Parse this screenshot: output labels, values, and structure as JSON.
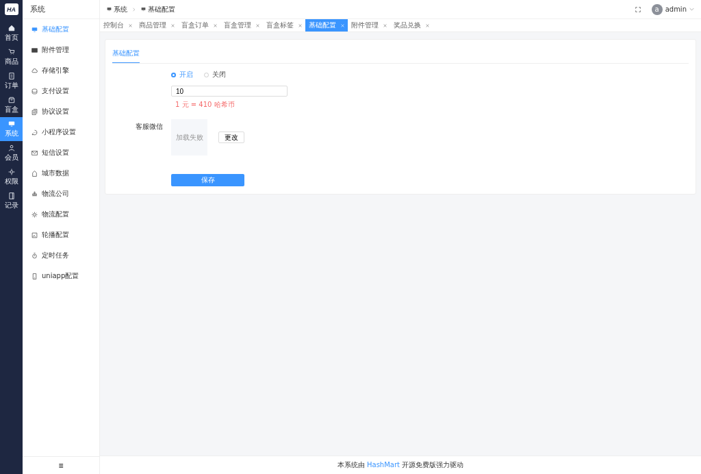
{
  "logo": "HA",
  "rail": [
    {
      "label": "首页",
      "selected": false
    },
    {
      "label": "商品",
      "selected": false
    },
    {
      "label": "订单",
      "selected": false
    },
    {
      "label": "盲盒",
      "selected": false
    },
    {
      "label": "系统",
      "selected": true
    },
    {
      "label": "会员",
      "selected": false
    },
    {
      "label": "权限",
      "selected": false
    },
    {
      "label": "记录",
      "selected": false
    }
  ],
  "sidebar": {
    "title": "系统",
    "items": [
      {
        "label": "基础配置",
        "selected": true
      },
      {
        "label": "附件管理",
        "selected": false
      },
      {
        "label": "存储引擎",
        "selected": false
      },
      {
        "label": "支付设置",
        "selected": false
      },
      {
        "label": "协议设置",
        "selected": false
      },
      {
        "label": "小程序设置",
        "selected": false
      },
      {
        "label": "短信设置",
        "selected": false
      },
      {
        "label": "城市数据",
        "selected": false
      },
      {
        "label": "物流公司",
        "selected": false
      },
      {
        "label": "物流配置",
        "selected": false
      },
      {
        "label": "轮播配置",
        "selected": false
      },
      {
        "label": "定时任务",
        "selected": false
      },
      {
        "label": "uniapp配置",
        "selected": false
      }
    ],
    "toggle": "≡"
  },
  "breadcrumb": [
    "系统",
    "基础配置"
  ],
  "user": {
    "avatar": "a",
    "name": "admin"
  },
  "tabs": [
    {
      "label": "控制台",
      "selected": false
    },
    {
      "label": "商品管理",
      "selected": false
    },
    {
      "label": "盲盒订单",
      "selected": false
    },
    {
      "label": "盲盒管理",
      "selected": false
    },
    {
      "label": "盲盒标签",
      "selected": false
    },
    {
      "label": "基础配置",
      "selected": true
    },
    {
      "label": "附件管理",
      "selected": false
    },
    {
      "label": "奖品兑换",
      "selected": false
    }
  ],
  "card": {
    "tab": "基础配置",
    "radios": [
      {
        "label": "开启",
        "selected": true
      },
      {
        "label": "关闭",
        "selected": false
      }
    ],
    "input_value": "10",
    "hint": "1 元 = 410 哈希币",
    "wechat_label": "客服微信",
    "image_error": "加载失败",
    "change_button": "更改",
    "save_button": "保存"
  },
  "footer": {
    "before": "本系统由",
    "link": "HashMart",
    "after": "开源免费版强力驱动"
  }
}
